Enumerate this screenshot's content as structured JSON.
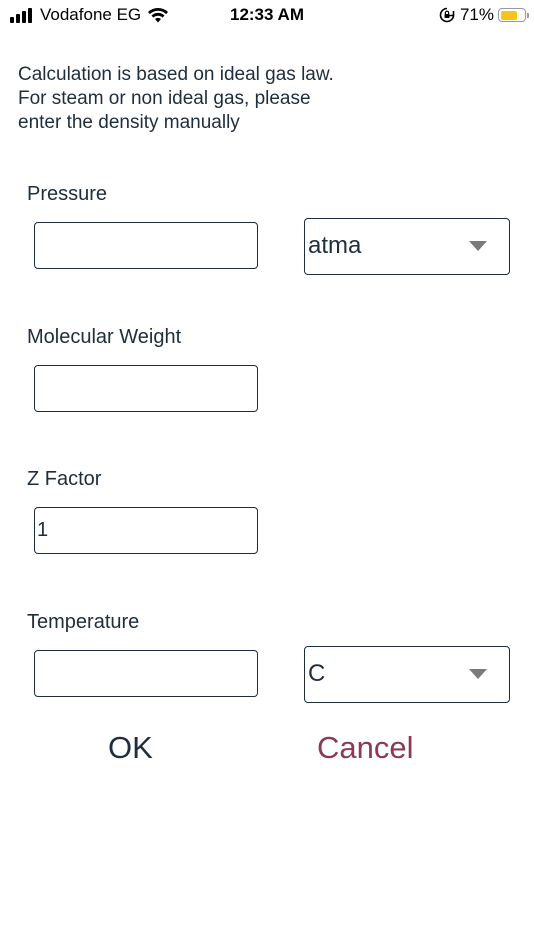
{
  "status_bar": {
    "carrier": "Vodafone EG",
    "time": "12:33 AM",
    "battery_percent": "71%",
    "battery_level": 0.71,
    "icons": [
      "signal-icon",
      "wifi-icon",
      "orientation-lock-icon",
      "battery-icon"
    ]
  },
  "info": {
    "lines": [
      "Calculation is based on ideal gas law.",
      "For steam or non ideal gas, please",
      "enter the density manually"
    ]
  },
  "form": {
    "pressure": {
      "label": "Pressure",
      "value": "",
      "unit": "atma"
    },
    "molecular_weight": {
      "label": "Molecular Weight",
      "value": ""
    },
    "z_factor": {
      "label": "Z Factor",
      "value": "1"
    },
    "temperature": {
      "label": "Temperature",
      "value": "",
      "unit": "C"
    }
  },
  "actions": {
    "ok_label": "OK",
    "cancel_label": "Cancel"
  },
  "colors": {
    "text": "#1f2d3d",
    "cancel": "#8b3a55",
    "dropdown_arrow": "#7a7a7a",
    "battery": "#f5c518"
  }
}
